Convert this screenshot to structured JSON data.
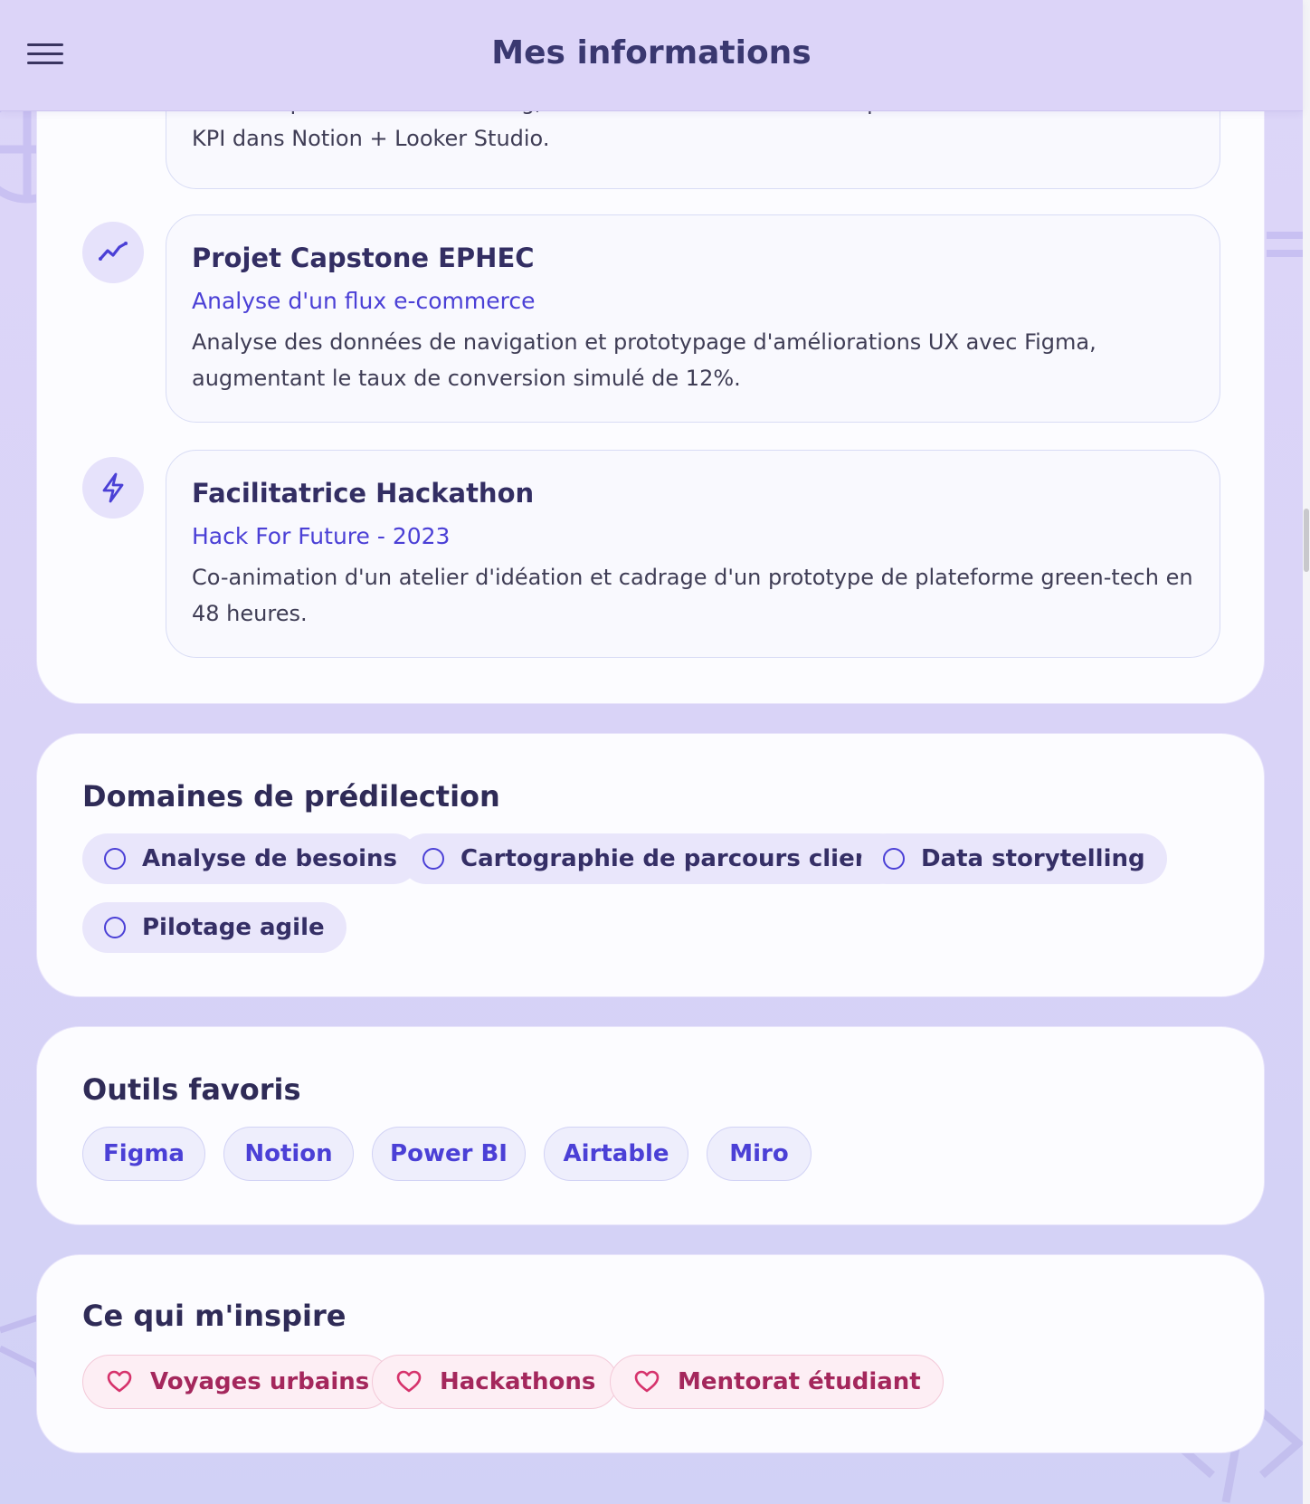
{
  "header": {
    "title": "Mes informations",
    "menu_icon": "hamburger-menu-icon"
  },
  "experiences": {
    "partial_desc": "Audit du parcours d'onboarding, interviews clients et mise en place d'un tableau de bord KPI dans Notion + Looker Studio.",
    "items": [
      {
        "icon": "trend-line-icon",
        "title": "Projet Capstone EPHEC",
        "subtitle": "Analyse d'un flux e-commerce",
        "description": "Analyse des données de navigation et prototypage d'améliorations UX avec Figma, augmentant le taux de conversion simulé de 12%."
      },
      {
        "icon": "lightning-icon",
        "title": "Facilitatrice Hackathon",
        "subtitle": "Hack For Future - 2023",
        "description": "Co-animation d'un atelier d'idéation et cadrage d'un prototype de plateforme green-tech en 48 heures."
      }
    ]
  },
  "domains": {
    "title": "Domaines de prédilection",
    "items": [
      "Analyse de besoins",
      "Cartographie de parcours client",
      "Data storytelling",
      "Pilotage agile"
    ]
  },
  "tools": {
    "title": "Outils favoris",
    "items": [
      "Figma",
      "Notion",
      "Power BI",
      "Airtable",
      "Miro"
    ]
  },
  "inspiration": {
    "title": "Ce qui m'inspire",
    "items": [
      "Voyages urbains",
      "Hackathons",
      "Mentorat étudiant"
    ]
  },
  "colors": {
    "accent": "#4b40d6",
    "heading": "#2f2b57",
    "pink": "#a4275c",
    "topbar": "#dcd4f8"
  }
}
